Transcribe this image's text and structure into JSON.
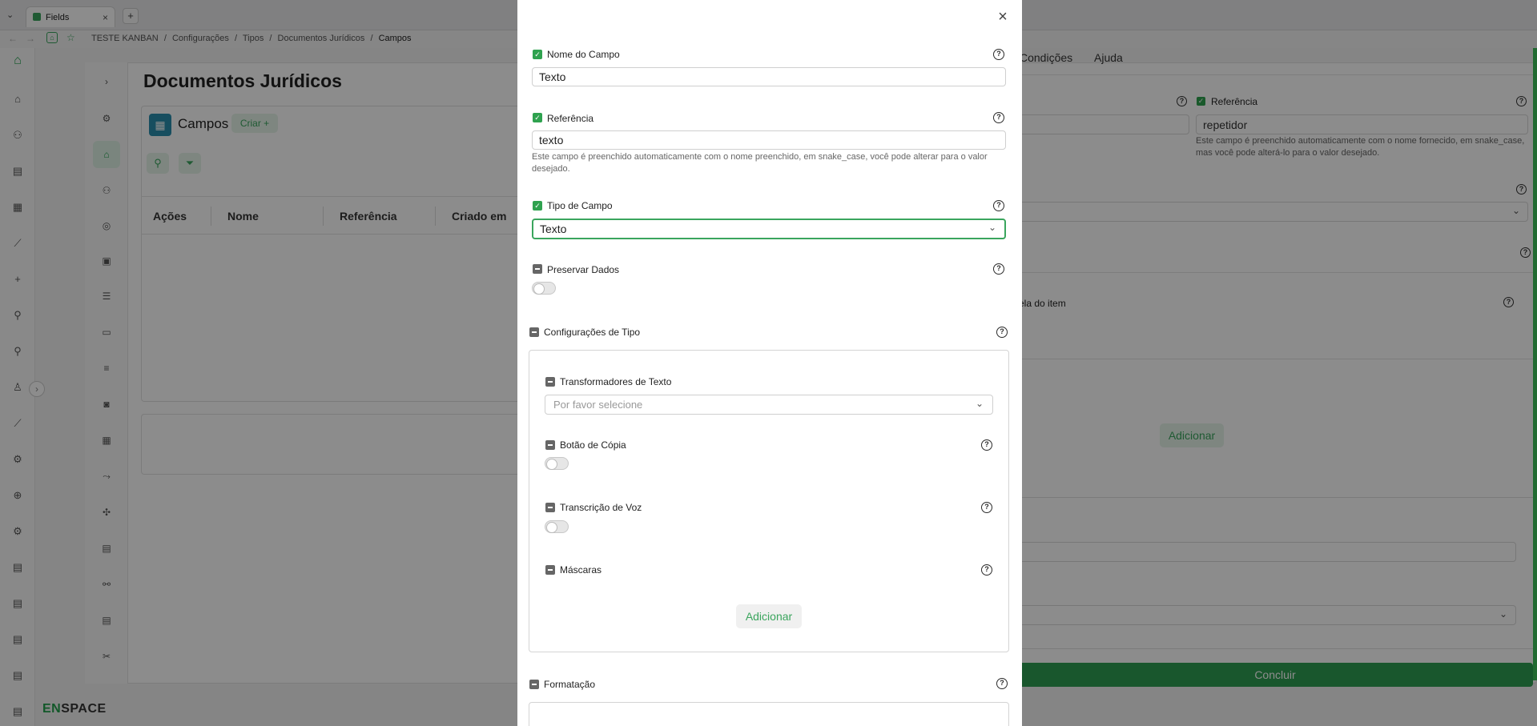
{
  "browser": {
    "tab_title": "Fields",
    "tab_close": "×",
    "new_tab": "+",
    "breadcrumb": [
      "TESTE KANBAN",
      "Configurações",
      "Tipos",
      "Documentos Jurídicos",
      "Campos"
    ],
    "breadcrumb_sep": "/"
  },
  "app": {
    "page_title": "Documentos Jurídicos",
    "section_title": "Campos",
    "create_button": "Criar +",
    "table_headers": [
      "Ações",
      "Nome",
      "Referência",
      "Criado em"
    ],
    "logo_prefix": "EN",
    "logo_suffix": "SPACE"
  },
  "background_form": {
    "tabs": [
      "Condições",
      "Ajuda"
    ],
    "reference_label": "Referência",
    "reference_value": "repetidor",
    "reference_help": "Este campo é preenchido automaticamente com o nome fornecido, em snake_case, mas você pode alterá-lo para o valor desejado.",
    "partial_label": "ela do item",
    "add_button": "Adicionar",
    "conclude_button": "Concluir"
  },
  "modal": {
    "close_icon": "×",
    "field_name": {
      "label": "Nome do Campo",
      "value": "Texto",
      "checked": true
    },
    "reference": {
      "label": "Referência",
      "value": "texto",
      "checked": true,
      "help": "Este campo é preenchido automaticamente com o nome preenchido, em snake_case, você pode alterar para o valor desejado."
    },
    "field_type": {
      "label": "Tipo de Campo",
      "value": "Texto",
      "checked": true
    },
    "preserve_data": {
      "label": "Preservar Dados",
      "enabled": false
    },
    "type_settings": {
      "label": "Configurações de Tipo",
      "text_transformers": {
        "label": "Transformadores de Texto",
        "placeholder": "Por favor selecione"
      },
      "copy_button": {
        "label": "Botão de Cópia",
        "enabled": false
      },
      "voice_transcription": {
        "label": "Transcrição de Voz",
        "enabled": false
      },
      "masks": {
        "label": "Máscaras",
        "add_button": "Adicionar"
      }
    },
    "formatting": {
      "label": "Formatação"
    }
  },
  "colors": {
    "accent": "#3aa55d",
    "check": "#2fa24f",
    "conclude": "#2f9e52",
    "scroll_indicator": "#3cc25a"
  }
}
